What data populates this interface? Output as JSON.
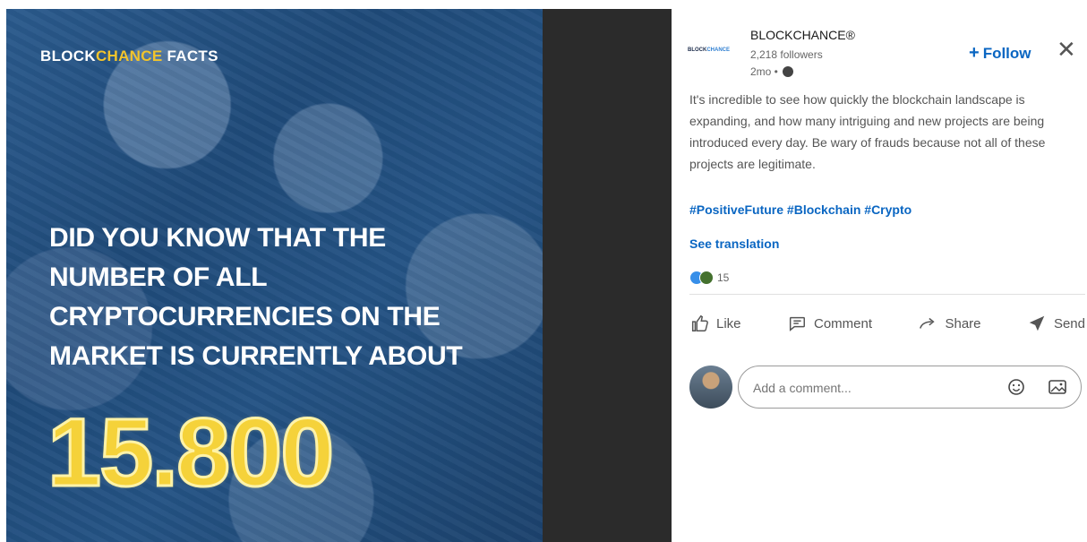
{
  "image": {
    "brand_part1": "BLOCK",
    "brand_part2": "CHANCE",
    "brand_part3": " FACTS",
    "headline_lines": [
      "DID YOU KNOW THAT THE",
      "NUMBER OF ALL",
      "CRYPTOCURRENCIES ON THE",
      "MARKET IS CURRENTLY ABOUT"
    ],
    "number": "15.800"
  },
  "post": {
    "author": "BLOCKCHANCE®",
    "logo_part1": "BLOCK",
    "logo_part2": "CHANCE",
    "followers": "2,218 followers",
    "time": "2mo •",
    "follow_label": "Follow",
    "close_symbol": "✕",
    "text": "It's incredible to see how quickly the blockchain landscape is expanding, and how many intriguing and new projects are being introduced every day. Be wary of frauds because not all of these projects are legitimate.",
    "hashtags": "#PositiveFuture #Blockchain #Crypto",
    "see_translation": "See translation",
    "reaction_count": "15",
    "actions": [
      {
        "label": "Like",
        "icon": "thumbs-up-icon"
      },
      {
        "label": "Comment",
        "icon": "comment-icon"
      },
      {
        "label": "Share",
        "icon": "share-arrow-icon"
      },
      {
        "label": "Send",
        "icon": "send-icon"
      }
    ],
    "comment_placeholder": "Add a comment...",
    "colors": {
      "link": "#0a66c2",
      "accent_yellow": "#f5d23a"
    }
  }
}
